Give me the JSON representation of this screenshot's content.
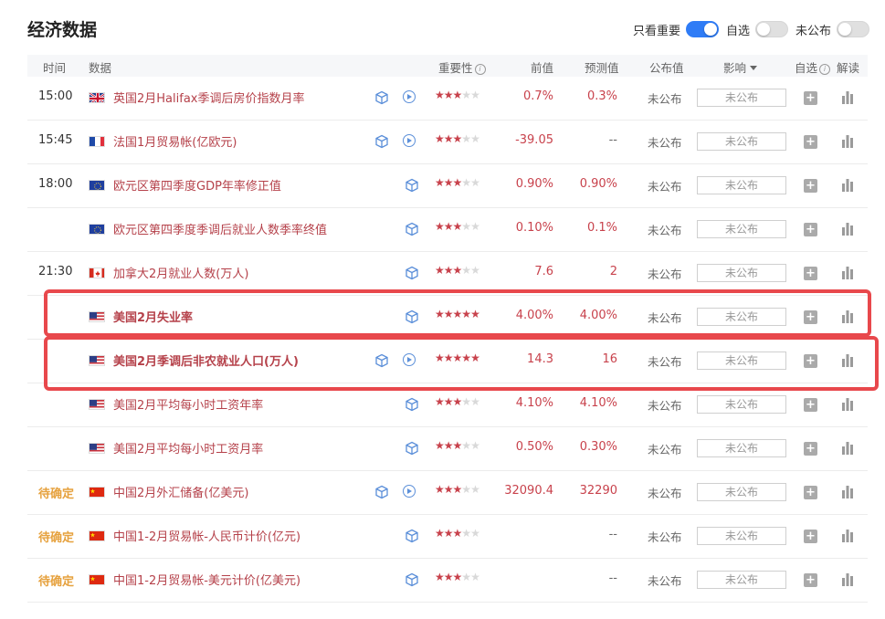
{
  "header": {
    "title": "经济数据",
    "filters": [
      {
        "label": "只看重要",
        "on": true
      },
      {
        "label": "自选",
        "on": false
      },
      {
        "label": "未公布",
        "on": false
      }
    ]
  },
  "columns": {
    "time": "时间",
    "data": "数据",
    "importance": "重要性",
    "previous": "前值",
    "forecast": "预测值",
    "actual": "公布值",
    "impact": "影响",
    "watch": "自选",
    "analysis": "解读"
  },
  "icons": {
    "cube": "cube-icon",
    "play": "play-icon",
    "add": "plus-icon",
    "chart": "bar-chart-icon"
  },
  "colors": {
    "accent_red": "#c8424c",
    "highlight_red": "#e8484c",
    "pending_orange": "#e6a13d",
    "toggle_blue": "#2f7cf6"
  },
  "rows": [
    {
      "time": "15:00",
      "flag": "uk",
      "name": "英国2月Halifax季调后房价指数月率",
      "stars": 3,
      "play": true,
      "prev": "0.7%",
      "forecast": "0.3%",
      "published": "未公布",
      "impact": "未公布",
      "bold": false
    },
    {
      "time": "15:45",
      "flag": "fr",
      "name": "法国1月贸易帐(亿欧元)",
      "stars": 3,
      "play": true,
      "prev": "-39.05",
      "forecast": "--",
      "published": "未公布",
      "impact": "未公布",
      "bold": false
    },
    {
      "time": "18:00",
      "flag": "eu",
      "name": "欧元区第四季度GDP年率修正值",
      "stars": 3,
      "play": false,
      "prev": "0.90%",
      "forecast": "0.90%",
      "published": "未公布",
      "impact": "未公布",
      "bold": false
    },
    {
      "time": "",
      "flag": "eu",
      "name": "欧元区第四季度季调后就业人数季率终值",
      "stars": 3,
      "play": false,
      "prev": "0.10%",
      "forecast": "0.1%",
      "published": "未公布",
      "impact": "未公布",
      "bold": false
    },
    {
      "time": "21:30",
      "flag": "ca",
      "name": "加拿大2月就业人数(万人)",
      "stars": 3,
      "play": false,
      "prev": "7.6",
      "forecast": "2",
      "published": "未公布",
      "impact": "未公布",
      "bold": false
    },
    {
      "time": "",
      "flag": "us",
      "name": "美国2月失业率",
      "stars": 5,
      "play": false,
      "prev": "4.00%",
      "forecast": "4.00%",
      "published": "未公布",
      "impact": "未公布",
      "bold": true
    },
    {
      "time": "",
      "flag": "us",
      "name": "美国2月季调后非农就业人口(万人)",
      "stars": 5,
      "play": true,
      "prev": "14.3",
      "forecast": "16",
      "published": "未公布",
      "impact": "未公布",
      "bold": true
    },
    {
      "time": "",
      "flag": "us",
      "name": "美国2月平均每小时工资年率",
      "stars": 3,
      "play": false,
      "prev": "4.10%",
      "forecast": "4.10%",
      "published": "未公布",
      "impact": "未公布",
      "bold": false
    },
    {
      "time": "",
      "flag": "us",
      "name": "美国2月平均每小时工资月率",
      "stars": 3,
      "play": false,
      "prev": "0.50%",
      "forecast": "0.30%",
      "published": "未公布",
      "impact": "未公布",
      "bold": false
    },
    {
      "time": "待确定",
      "flag": "cn",
      "name": "中国2月外汇储备(亿美元)",
      "stars": 3,
      "play": true,
      "prev": "32090.4",
      "forecast": "32290",
      "published": "未公布",
      "impact": "未公布",
      "bold": false
    },
    {
      "time": "待确定",
      "flag": "cn",
      "name": "中国1-2月贸易帐-人民币计价(亿元)",
      "stars": 3,
      "play": false,
      "prev": "",
      "forecast": "--",
      "published": "未公布",
      "impact": "未公布",
      "bold": false
    },
    {
      "time": "待确定",
      "flag": "cn",
      "name": "中国1-2月贸易帐-美元计价(亿美元)",
      "stars": 3,
      "play": false,
      "prev": "",
      "forecast": "--",
      "published": "未公布",
      "impact": "未公布",
      "bold": false
    }
  ]
}
